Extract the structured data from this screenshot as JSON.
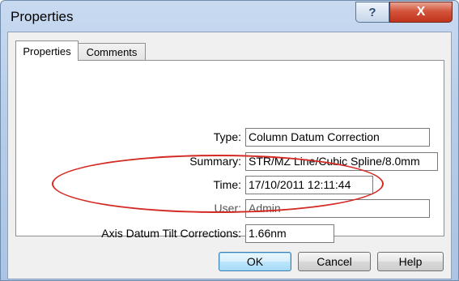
{
  "window": {
    "title": "Properties",
    "help_glyph": "?",
    "close_glyph": "X"
  },
  "tabs": [
    {
      "label": "Properties",
      "active": true
    },
    {
      "label": "Comments",
      "active": false
    }
  ],
  "fields": {
    "type": {
      "label": "Type:",
      "value": "Column Datum Correction"
    },
    "summary": {
      "label": "Summary:",
      "value": "STR/MZ Line/Cubic Spline/8.0mm"
    },
    "time": {
      "label": "Time:",
      "value": "17/10/2011 12:11:44"
    },
    "user": {
      "label": "User:",
      "value": "Admin"
    },
    "axis_tilt": {
      "label": "Axis Datum Tilt Corrections:",
      "value": "1.66nm"
    }
  },
  "buttons": {
    "ok": "OK",
    "cancel": "Cancel",
    "help": "Help"
  },
  "colors": {
    "highlight_ellipse": "#d42a24",
    "close_button": "#c0331b"
  }
}
